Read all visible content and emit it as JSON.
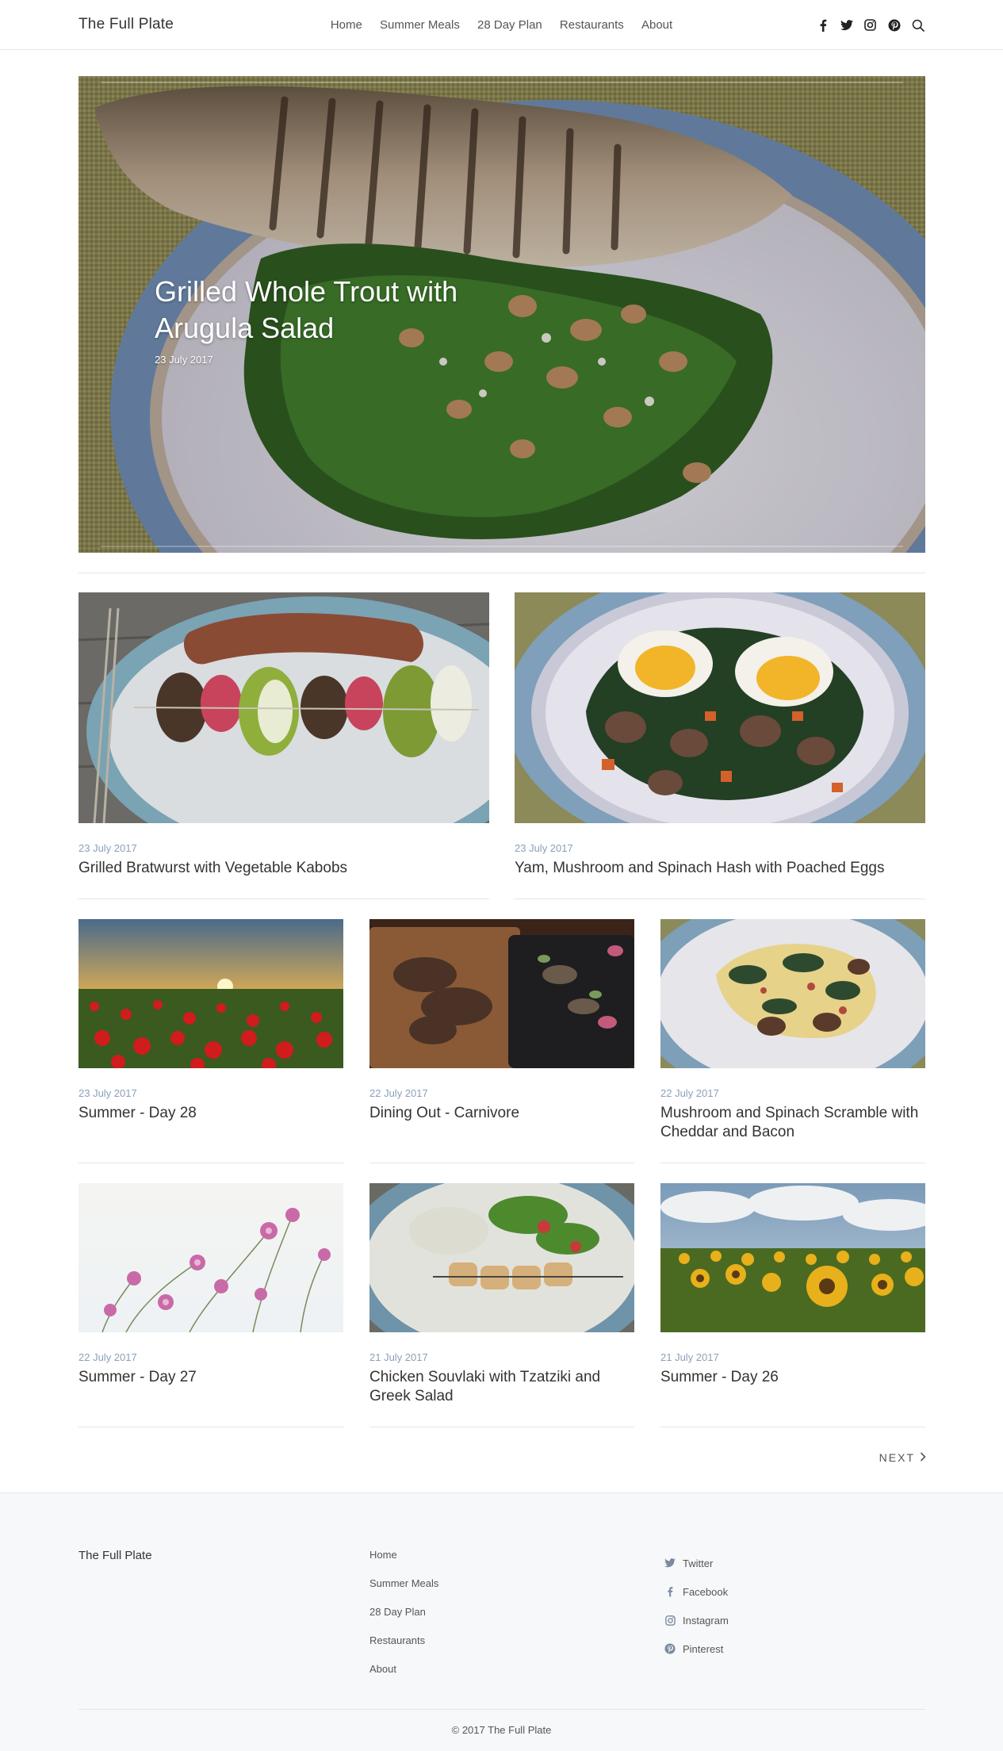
{
  "header": {
    "site_title": "The Full Plate",
    "nav": [
      "Home",
      "Summer Meals",
      "28 Day Plan",
      "Restaurants",
      "About"
    ],
    "social_icons": [
      "facebook-icon",
      "twitter-icon",
      "instagram-icon",
      "pinterest-icon",
      "search-icon"
    ]
  },
  "hero": {
    "title": "Grilled Whole Trout with Arugula Salad",
    "date": "23 July 2017"
  },
  "posts": [
    {
      "date": "23 July 2017",
      "title": "Grilled Bratwurst with Vegetable Kabobs"
    },
    {
      "date": "23 July 2017",
      "title": "Yam, Mushroom and Spinach Hash with Poached Eggs"
    },
    {
      "date": "23 July 2017",
      "title": "Summer - Day 28"
    },
    {
      "date": "22 July 2017",
      "title": "Dining Out - Carnivore"
    },
    {
      "date": "22 July 2017",
      "title": "Mushroom and Spinach Scramble with Cheddar and Bacon"
    },
    {
      "date": "22 July 2017",
      "title": "Summer - Day 27"
    },
    {
      "date": "21 July 2017",
      "title": "Chicken Souvlaki with Tzatziki and Greek Salad"
    },
    {
      "date": "21 July 2017",
      "title": "Summer - Day 26"
    }
  ],
  "pagination": {
    "next_label": "NEXT"
  },
  "footer": {
    "site_title": "The Full Plate",
    "links": [
      "Home",
      "Summer Meals",
      "28 Day Plan",
      "Restaurants",
      "About"
    ],
    "social": [
      {
        "label": "Twitter",
        "icon": "twitter-icon"
      },
      {
        "label": "Facebook",
        "icon": "facebook-icon"
      },
      {
        "label": "Instagram",
        "icon": "instagram-icon"
      },
      {
        "label": "Pinterest",
        "icon": "pinterest-icon"
      }
    ],
    "copyright": "© 2017 The Full Plate"
  },
  "colors": {
    "accent_date": "#8aa0b8",
    "footer_bg": "#f7f8fa",
    "rule": "#e6e6e6"
  }
}
